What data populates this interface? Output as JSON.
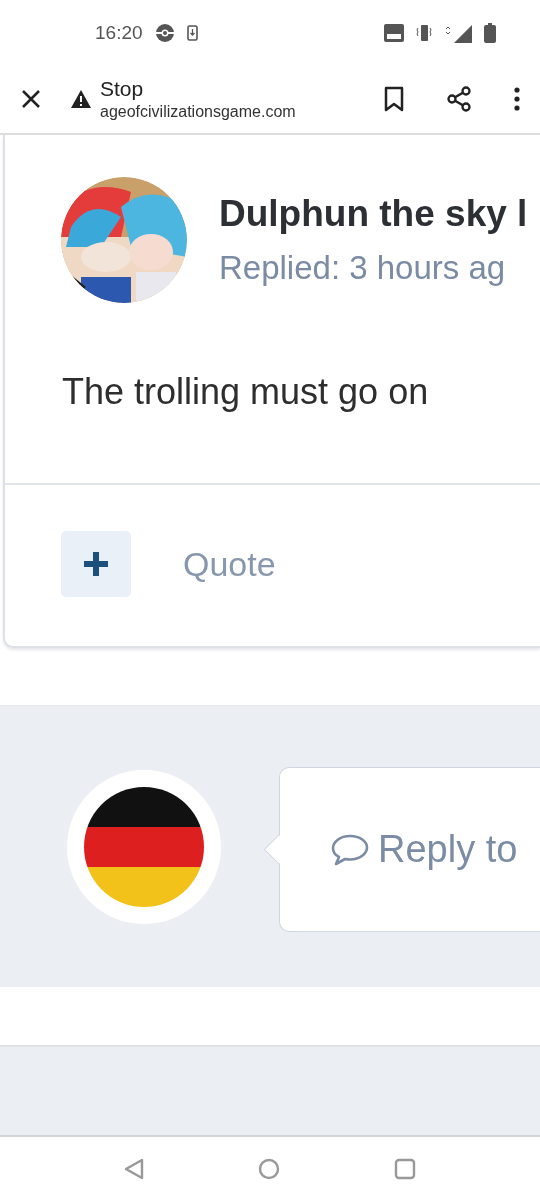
{
  "status_bar": {
    "time": "16:20"
  },
  "browser_bar": {
    "title": "Stop",
    "url": "ageofcivilizationsgame.com"
  },
  "post": {
    "author": "Dulphun the sky l",
    "meta": "Replied: 3 hours ag",
    "body": "The trolling must go on",
    "quote_label": "Quote"
  },
  "reply": {
    "prompt": "Reply to"
  }
}
